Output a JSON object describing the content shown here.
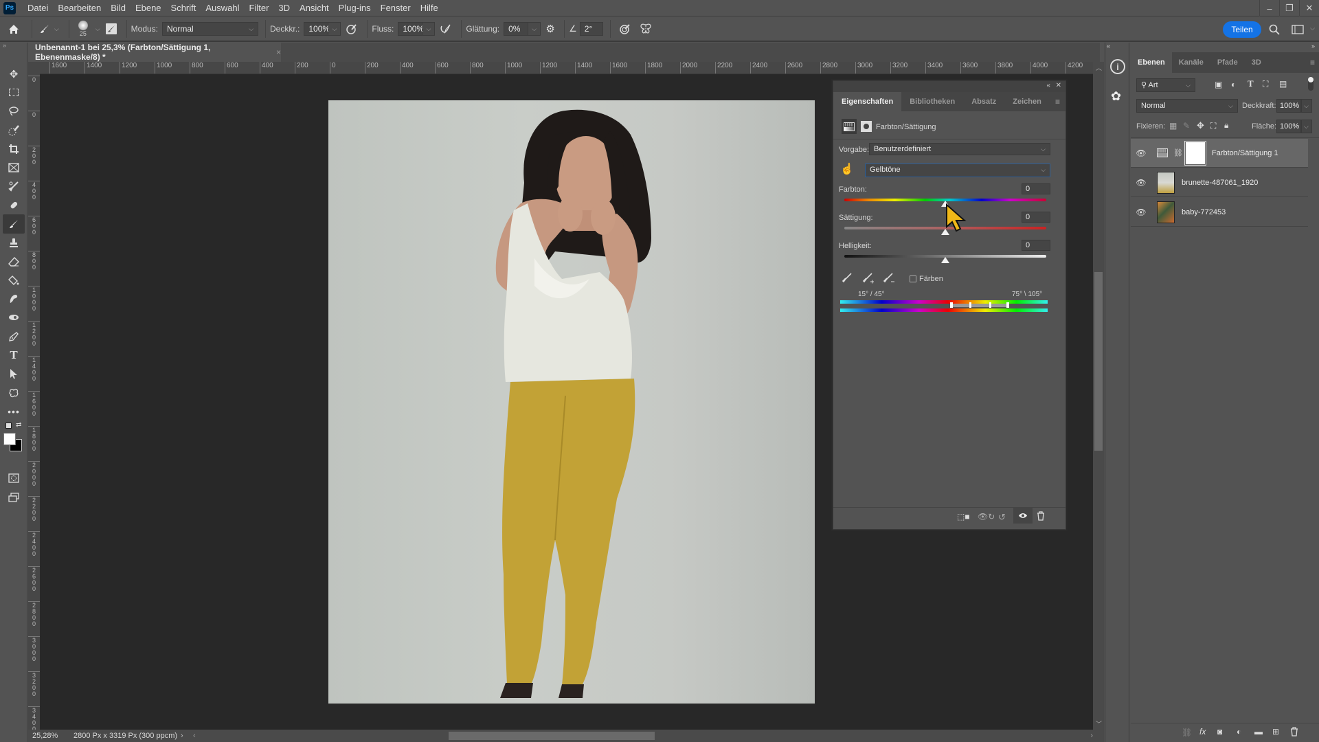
{
  "app": {
    "logo": "Ps"
  },
  "menu": [
    "Datei",
    "Bearbeiten",
    "Bild",
    "Ebene",
    "Schrift",
    "Auswahl",
    "Filter",
    "3D",
    "Ansicht",
    "Plug-ins",
    "Fenster",
    "Hilfe"
  ],
  "window_controls": {
    "minimize": "–",
    "restore": "❐",
    "close": "✕"
  },
  "options_bar": {
    "brush_size": "25",
    "mode_label": "Modus:",
    "mode_value": "Normal",
    "opacity_label": "Deckkr.:",
    "opacity_value": "100%",
    "flow_label": "Fluss:",
    "flow_value": "100%",
    "smoothing_label": "Glättung:",
    "smoothing_value": "0%",
    "angle_value": "2°",
    "share_label": "Teilen"
  },
  "document": {
    "tab_title": "Unbenannt-1 bei 25,3% (Farbton/Sättigung 1, Ebenenmaske/8) *",
    "close": "×",
    "zoom": "25,28%",
    "info": "2800 Px x 3319 Px (300 ppcm)"
  },
  "rulers": {
    "horizontal": [
      "1600",
      "1400",
      "1200",
      "1000",
      "800",
      "600",
      "400",
      "200",
      "0",
      "200",
      "400",
      "600",
      "800",
      "1000",
      "1200",
      "1400",
      "1600",
      "1800",
      "2000",
      "2200",
      "2400",
      "2600",
      "2800",
      "3000",
      "3200",
      "3400",
      "3600",
      "3800",
      "4000",
      "4200"
    ],
    "vertical": [
      "0",
      "0",
      "200",
      "400",
      "600",
      "800",
      "1000",
      "1200",
      "1400",
      "1600",
      "1800",
      "2000",
      "2200",
      "2400",
      "2600",
      "2800",
      "3000",
      "3200",
      "3400"
    ]
  },
  "properties": {
    "tabs": [
      "Eigenschaften",
      "Bibliotheken",
      "Absatz",
      "Zeichen"
    ],
    "active_tab": 0,
    "adjustment_title": "Farbton/Sättigung",
    "preset_label": "Vorgabe:",
    "preset_value": "Benutzerdefiniert",
    "channel_value": "Gelbtöne",
    "hue_label": "Farbton:",
    "hue_value": "0",
    "saturation_label": "Sättigung:",
    "saturation_value": "0",
    "lightness_label": "Helligkeit:",
    "lightness_value": "0",
    "colorize_label": "Färben",
    "colorize_checked": false,
    "range_left": "15° / 45°",
    "range_right": "75° \\ 105°"
  },
  "layers_panel": {
    "tabs": [
      "Ebenen",
      "Kanäle",
      "Pfade",
      "3D"
    ],
    "active_tab": 0,
    "filter_value": "Art",
    "blend_mode": "Normal",
    "opacity_label": "Deckkraft:",
    "opacity_value": "100%",
    "lock_label": "Fixieren:",
    "fill_label": "Fläche:",
    "fill_value": "100%",
    "layers": [
      {
        "name": "Farbton/Sättigung 1",
        "selected": true,
        "visible": true
      },
      {
        "name": "brunette-487061_1920",
        "selected": false,
        "visible": true
      },
      {
        "name": "baby-772453",
        "selected": false,
        "visible": true
      }
    ]
  }
}
